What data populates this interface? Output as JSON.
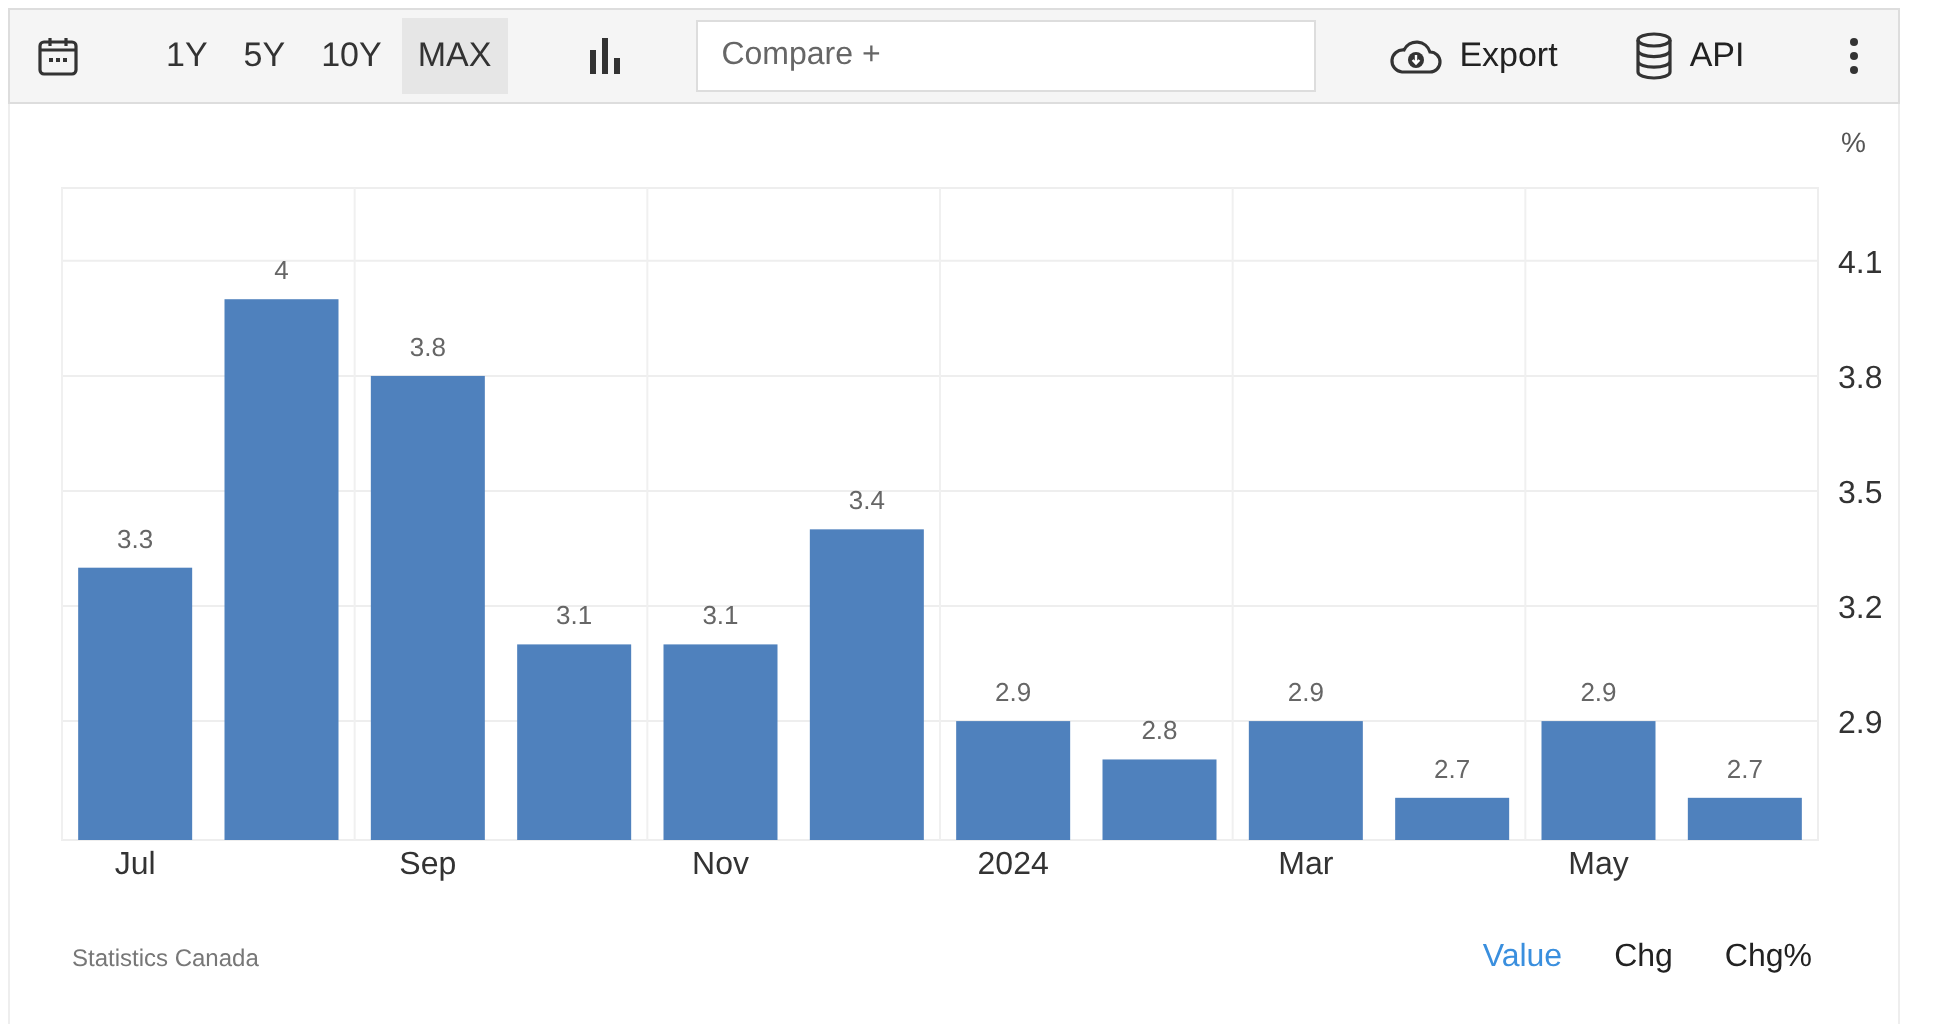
{
  "toolbar": {
    "ranges": [
      {
        "label": "1Y",
        "selected": false
      },
      {
        "label": "5Y",
        "selected": false
      },
      {
        "label": "10Y",
        "selected": false
      },
      {
        "label": "MAX",
        "selected": true
      }
    ],
    "compare": {
      "placeholder": "Compare +"
    },
    "actions": [
      {
        "kind": "export",
        "label": "Export"
      },
      {
        "kind": "api",
        "label": "API"
      }
    ]
  },
  "chart": {
    "chart_data": {
      "type": "bar",
      "ylabel": "%",
      "categories": [
        "Jul",
        null,
        "Sep",
        null,
        "Nov",
        null,
        "2024",
        null,
        "Mar",
        null,
        "May",
        null
      ],
      "series": [
        {
          "color": "#4f81bd",
          "values": [
            3.3,
            4,
            3.8,
            3.1,
            3.1,
            3.4,
            2.9,
            2.8,
            2.9,
            2.7,
            2.9,
            2.7
          ]
        }
      ],
      "ylim": [
        2.59,
        4.29
      ],
      "yticks": [
        2.9,
        3.2,
        3.5,
        3.8,
        4.1
      ],
      "data_labels": true,
      "grid": true
    }
  },
  "footer": {
    "source": "Statistics Canada",
    "modes": [
      {
        "label": "Value",
        "selected": true
      },
      {
        "label": "Chg",
        "selected": false
      },
      {
        "label": "Chg%",
        "selected": false
      }
    ]
  }
}
